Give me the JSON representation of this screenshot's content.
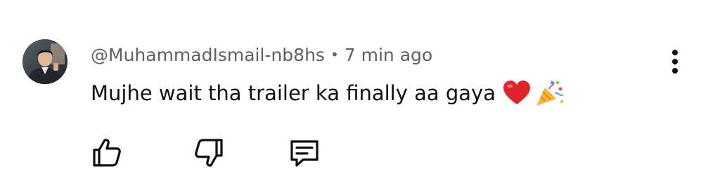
{
  "comment": {
    "username": "@MuhammadIsmail-nb8hs",
    "separator": "•",
    "timestamp": "7 min ago",
    "text": "Mujhe wait tha trailer ka finally aa gaya",
    "emojis": [
      "heart-emoji",
      "party-popper-emoji"
    ]
  },
  "actions": {
    "like_icon": "thumbs-up-icon",
    "dislike_icon": "thumbs-down-icon",
    "reply_icon": "comment-icon",
    "more_icon": "more-vertical-icon"
  },
  "colors": {
    "username": "#606060",
    "text": "#0f0f0f",
    "heart": "#e0242b"
  }
}
